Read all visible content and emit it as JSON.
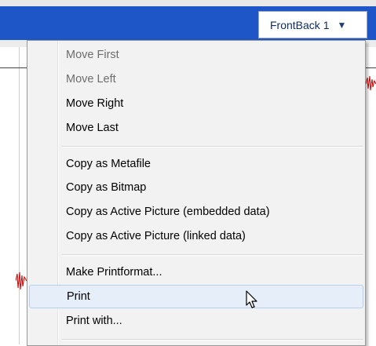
{
  "toolbar": {
    "tab_label": "FrontBack 1",
    "tab_caret": "▼"
  },
  "menu": {
    "items": [
      {
        "label": "Move First",
        "enabled": false
      },
      {
        "label": "Move Left",
        "enabled": false
      },
      {
        "label": "Move Right",
        "enabled": true
      },
      {
        "label": "Move Last",
        "enabled": true
      },
      {
        "label": "Copy as Metafile",
        "enabled": true
      },
      {
        "label": "Copy as Bitmap",
        "enabled": true
      },
      {
        "label": "Copy as Active Picture (embedded data)",
        "enabled": true
      },
      {
        "label": "Copy as Active Picture (linked data)",
        "enabled": true
      },
      {
        "label": "Make Printformat...",
        "enabled": true
      },
      {
        "label": "Print",
        "enabled": true,
        "highlighted": true
      },
      {
        "label": "Print with...",
        "enabled": true
      }
    ]
  },
  "colors": {
    "title_bar": "#1e56c8",
    "menu_background": "#f2f2f2",
    "hover_fill": "#e6eff9",
    "waveform": "#cc0000"
  },
  "icons": {
    "cursor": "mouse-pointer-icon",
    "tab_dropdown": "chevron-down-icon"
  }
}
